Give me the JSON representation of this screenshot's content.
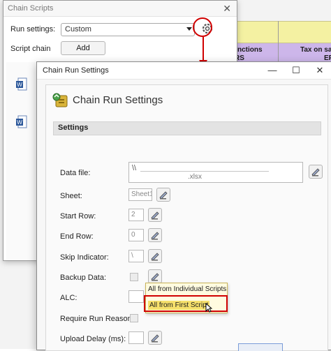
{
  "background_sheet": {
    "header_1": "nctions",
    "header_1b": "RS",
    "header_2": "Tax on sa",
    "header_2b": "ER"
  },
  "chain_scripts": {
    "title": "Chain Scripts",
    "run_settings_label": "Run settings:",
    "run_settings_value": "Custom",
    "script_chain_label": "Script chain",
    "add_label": "Add",
    "list_items": [
      "M",
      "M"
    ]
  },
  "chain_run_settings": {
    "window_title": "Chain Run Settings",
    "header": "Chain Run Settings",
    "section": "Settings",
    "fields": {
      "data_file_label": "Data file:",
      "data_file_value_prefix": "\\\\",
      "data_file_value_suffix": ".xlsx",
      "sheet_label": "Sheet:",
      "sheet_value": "Sheet1",
      "start_row_label": "Start Row:",
      "start_row_value": "2",
      "end_row_label": "End Row:",
      "end_row_value": "0",
      "skip_indicator_label": "Skip Indicator:",
      "skip_indicator_value": "\\",
      "backup_data_label": "Backup Data:",
      "alc_label": "ALC:",
      "require_run_reason_label": "Require Run Reason:",
      "upload_delay_label": "Upload Delay (ms):"
    },
    "alc_menu": {
      "items": [
        "All from Individual Scripts",
        "All from First Script"
      ],
      "selected_index": 1
    }
  },
  "colors": {
    "accent_red": "#d00000",
    "menu_bg": "#fffbe0",
    "menu_selected": "#f6e06b",
    "sheet_yellow": "#f4f1a2",
    "sheet_purple": "#cdb6ea"
  }
}
